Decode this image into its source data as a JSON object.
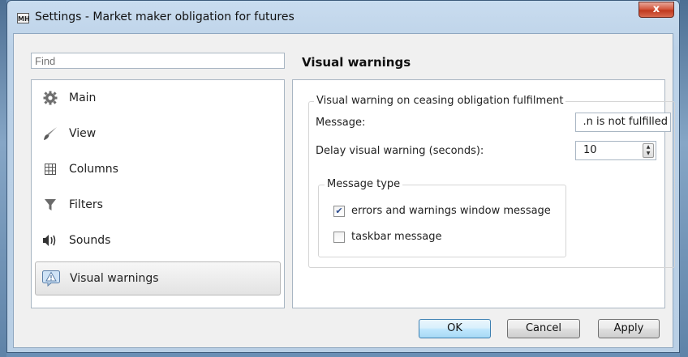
{
  "window": {
    "app_icon_text": "MH",
    "title": "Settings - Market maker obligation for futures",
    "close_label": "x"
  },
  "sidebar": {
    "find_placeholder": "Find",
    "items": [
      {
        "label": "Main",
        "icon": "gear-icon"
      },
      {
        "label": "View",
        "icon": "brush-icon"
      },
      {
        "label": "Columns",
        "icon": "grid-icon"
      },
      {
        "label": "Filters",
        "icon": "funnel-icon"
      },
      {
        "label": "Sounds",
        "icon": "speaker-icon"
      },
      {
        "label": "Visual warnings",
        "icon": "warning-icon",
        "selected": true
      }
    ]
  },
  "panel": {
    "title": "Visual warnings",
    "group_label": "Visual warning on ceasing obligation fulfilment",
    "message_label": "Message:",
    "message_value": "n is not fulfilled.",
    "delay_label": "Delay visual warning (seconds):",
    "delay_value": "10",
    "message_type": {
      "label": "Message type",
      "options": [
        {
          "label": "errors and warnings window message",
          "checked": true
        },
        {
          "label": "taskbar message",
          "checked": false
        }
      ]
    }
  },
  "buttons": {
    "ok": "OK",
    "cancel": "Cancel",
    "apply": "Apply"
  },
  "colors": {
    "title_bar": "#bcd2e8",
    "close_button": "#c0391f",
    "default_button": "#bee6fd"
  }
}
